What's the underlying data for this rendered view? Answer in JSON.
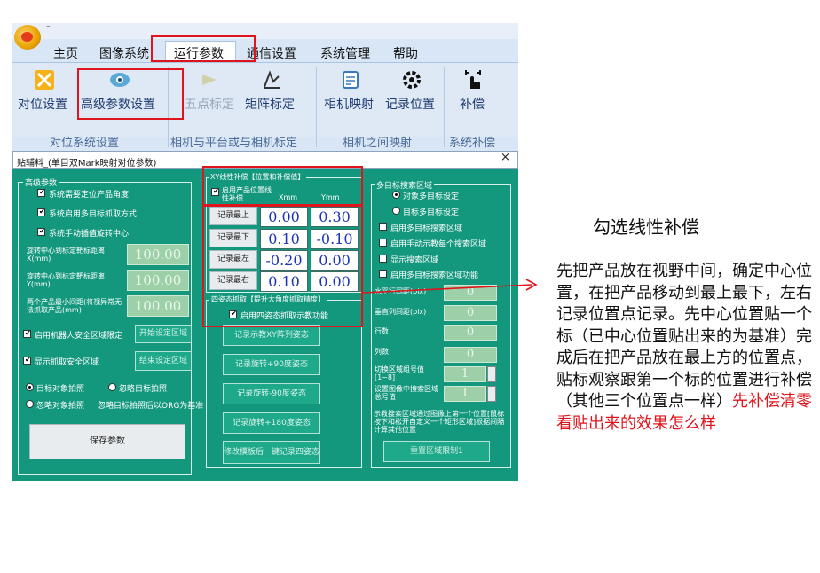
{
  "menu": [
    "主页",
    "图像系统",
    "运行参数",
    "通信设置",
    "系统管理",
    "帮助"
  ],
  "quick_access": "⁼",
  "ribbon": {
    "buttons": [
      "对位设置",
      "高级参数设置",
      "五点标定",
      "矩阵标定",
      "相机映射",
      "记录位置",
      "补偿"
    ],
    "groups": [
      "对位系统设置",
      "相机与平台或与相机标定",
      "相机之间映射",
      "系统补偿"
    ]
  },
  "dialog": {
    "title": "贴辅料_(单目双Mark映射对位参数)",
    "close": "×",
    "advanced": {
      "group": "高级参数",
      "chk_locate": "系统需要定位产品角度",
      "chk_multi": "系统启用多目标抓取方式",
      "chk_manual": "系统手动插值旋转中心",
      "rot_x_label": "旋转中心到标定靶标距离X(mm)",
      "rot_x": "100.00",
      "rot_y_label": "旋转中心到标定靶标距离Y(mm)",
      "rot_y": "100.00",
      "min_gap_label": "两个产品最小间距(将视异常无法抓取产品(mm)",
      "min_gap": "100.00",
      "chk_robot": "启用机器人安全区域限定",
      "btn_start": "开始设定区域",
      "chk_show": "显示抓取安全区域",
      "btn_end": "结束设定区域",
      "radio_target": "目标对象拍照",
      "radio_ignore_target": "忽略目标拍照",
      "radio_ignore_obj": "忽略对象拍照",
      "ignore_note": "忽略目标拍照后以ORG为基准",
      "save": "保存参数"
    },
    "linear": {
      "group": "XY线性补偿【位置和补偿值】",
      "chk": "启用产品位置线性补偿",
      "col_x": "Xmm",
      "col_y": "Ymm",
      "rows": [
        {
          "label": "记录最上",
          "x": "0.00",
          "y": "0.30"
        },
        {
          "label": "记录最下",
          "x": "0.10",
          "y": "-0.10"
        },
        {
          "label": "记录最左",
          "x": "-0.20",
          "y": "0.00"
        },
        {
          "label": "记录最右",
          "x": "0.10",
          "y": "0.00"
        }
      ]
    },
    "four_pose": {
      "group": "四姿态抓取【提升大角度抓取精度】",
      "chk": "启用四姿态抓取示教功能",
      "buttons": [
        "记录示教XY阵列姿态",
        "记录旋转+90度姿态",
        "记录旋转-90度姿态",
        "记录旋转+180度姿态",
        "修改模板后一键记录四姿态"
      ]
    },
    "multi_target": {
      "group": "多目标搜索区域",
      "radio_multi": "对象多目标设定",
      "radio_target": "目标多目标设定",
      "chk_multi_search": "启用多目标搜索区域",
      "chk_manual_multi": "启用手动示教每个搜索区域",
      "chk_show_search": "显示搜索区域",
      "chk_fill": "启用多目标搜索区域功能",
      "h_gap_label": "水平行间距(pix)",
      "h_gap": "0",
      "v_gap_label": "垂直列间距(pix)",
      "v_gap": "0",
      "rows_label": "行数",
      "rows": "0",
      "cols_label": "列数",
      "cols": "0",
      "switch_label": "切换区域组号值[1~8]",
      "switch": "1",
      "set_img_label": "设置图像中搜索区域总号值",
      "set_img": "1",
      "hint": "示教搜索区域通过图像上第一个位置[鼠标按下和松开自定义一个矩形区域]根据间隔计算其他位置",
      "reset": "重置区域限制1"
    }
  },
  "annotation": {
    "title": "勾选线性补偿",
    "body": "先把产品放在视野中间，确定中心位置，在把产品移动到最上最下，左右记录位置点记录。先中心位置贴一个标（已中心位置贴出来的为基准）完成后在把产品放在最上方的位置点，贴标观察跟第一个标的位置进行补偿（其他三个位置点一样）",
    "red": "先补偿清零看贴出来的效果怎么样"
  },
  "colors": {
    "dialog_bg": "#13977d",
    "highlight": "#e0141c",
    "value_text": "#1b33b5"
  }
}
